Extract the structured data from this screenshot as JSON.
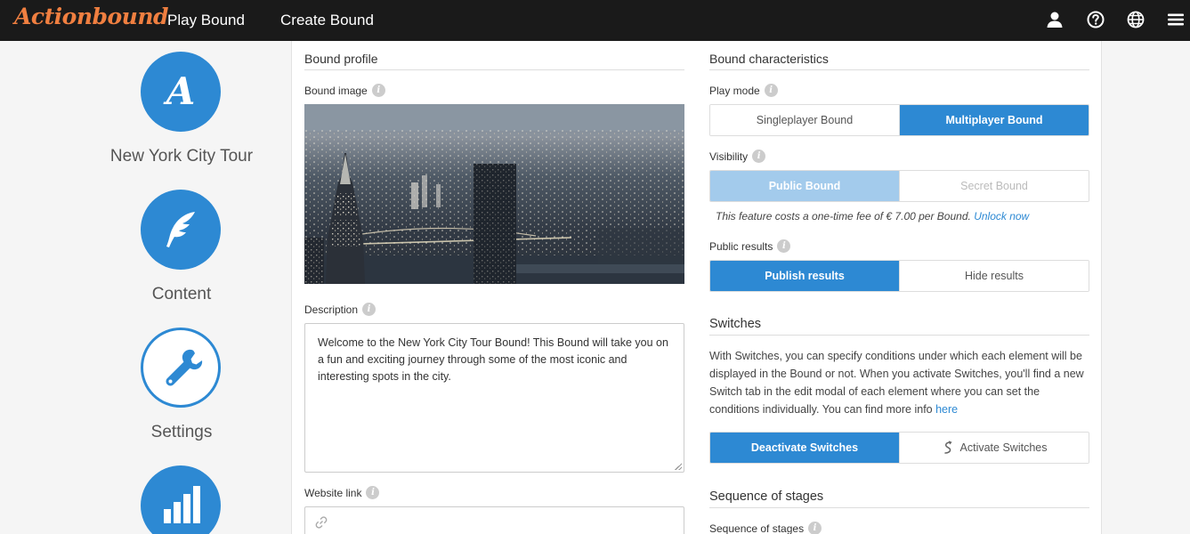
{
  "header": {
    "logo": "Actionbound",
    "nav": [
      "Play Bound",
      "Create Bound"
    ],
    "icons": [
      "user-icon",
      "help-icon",
      "globe-icon",
      "menu-icon"
    ]
  },
  "sidebar": {
    "items": [
      {
        "label": "New York City Tour",
        "icon": "actionbound-logo-icon"
      },
      {
        "label": "Content",
        "icon": "feather-icon"
      },
      {
        "label": "Settings",
        "icon": "wrench-icon"
      },
      {
        "label": "",
        "icon": "bar-chart-icon"
      }
    ]
  },
  "profile": {
    "title": "Bound profile",
    "image_label": "Bound image",
    "description_label": "Description",
    "description": "Welcome to the New York City Tour Bound! This Bound will take you on a fun and exciting journey through some of the most iconic and interesting spots in the city.",
    "website_label": "Website link"
  },
  "characteristics": {
    "title": "Bound characteristics",
    "play_mode_label": "Play mode",
    "play_mode_options": [
      "Singleplayer Bound",
      "Multiplayer Bound"
    ],
    "visibility_label": "Visibility",
    "visibility_options": [
      "Public Bound",
      "Secret Bound"
    ],
    "fee_note": "This feature costs a one-time fee of € 7.00 per Bound.",
    "unlock_link": "Unlock now",
    "public_results_label": "Public results",
    "results_options": [
      "Publish results",
      "Hide results"
    ]
  },
  "switches": {
    "title": "Switches",
    "text": "With Switches, you can specify conditions under which each element will be displayed in the Bound or not. When you activate Switches, you'll find a new Switch tab in the edit modal of each element where you can set the conditions individually. You can find more info",
    "here_link": "here",
    "options": [
      "Deactivate Switches",
      "Activate Switches"
    ]
  },
  "sequence": {
    "title": "Sequence of stages",
    "label": "Sequence of stages"
  },
  "colors": {
    "accent": "#2d89d3",
    "accent_light": "#a3cbec",
    "logo": "#f07f40",
    "topbar": "#1a1a1a"
  }
}
